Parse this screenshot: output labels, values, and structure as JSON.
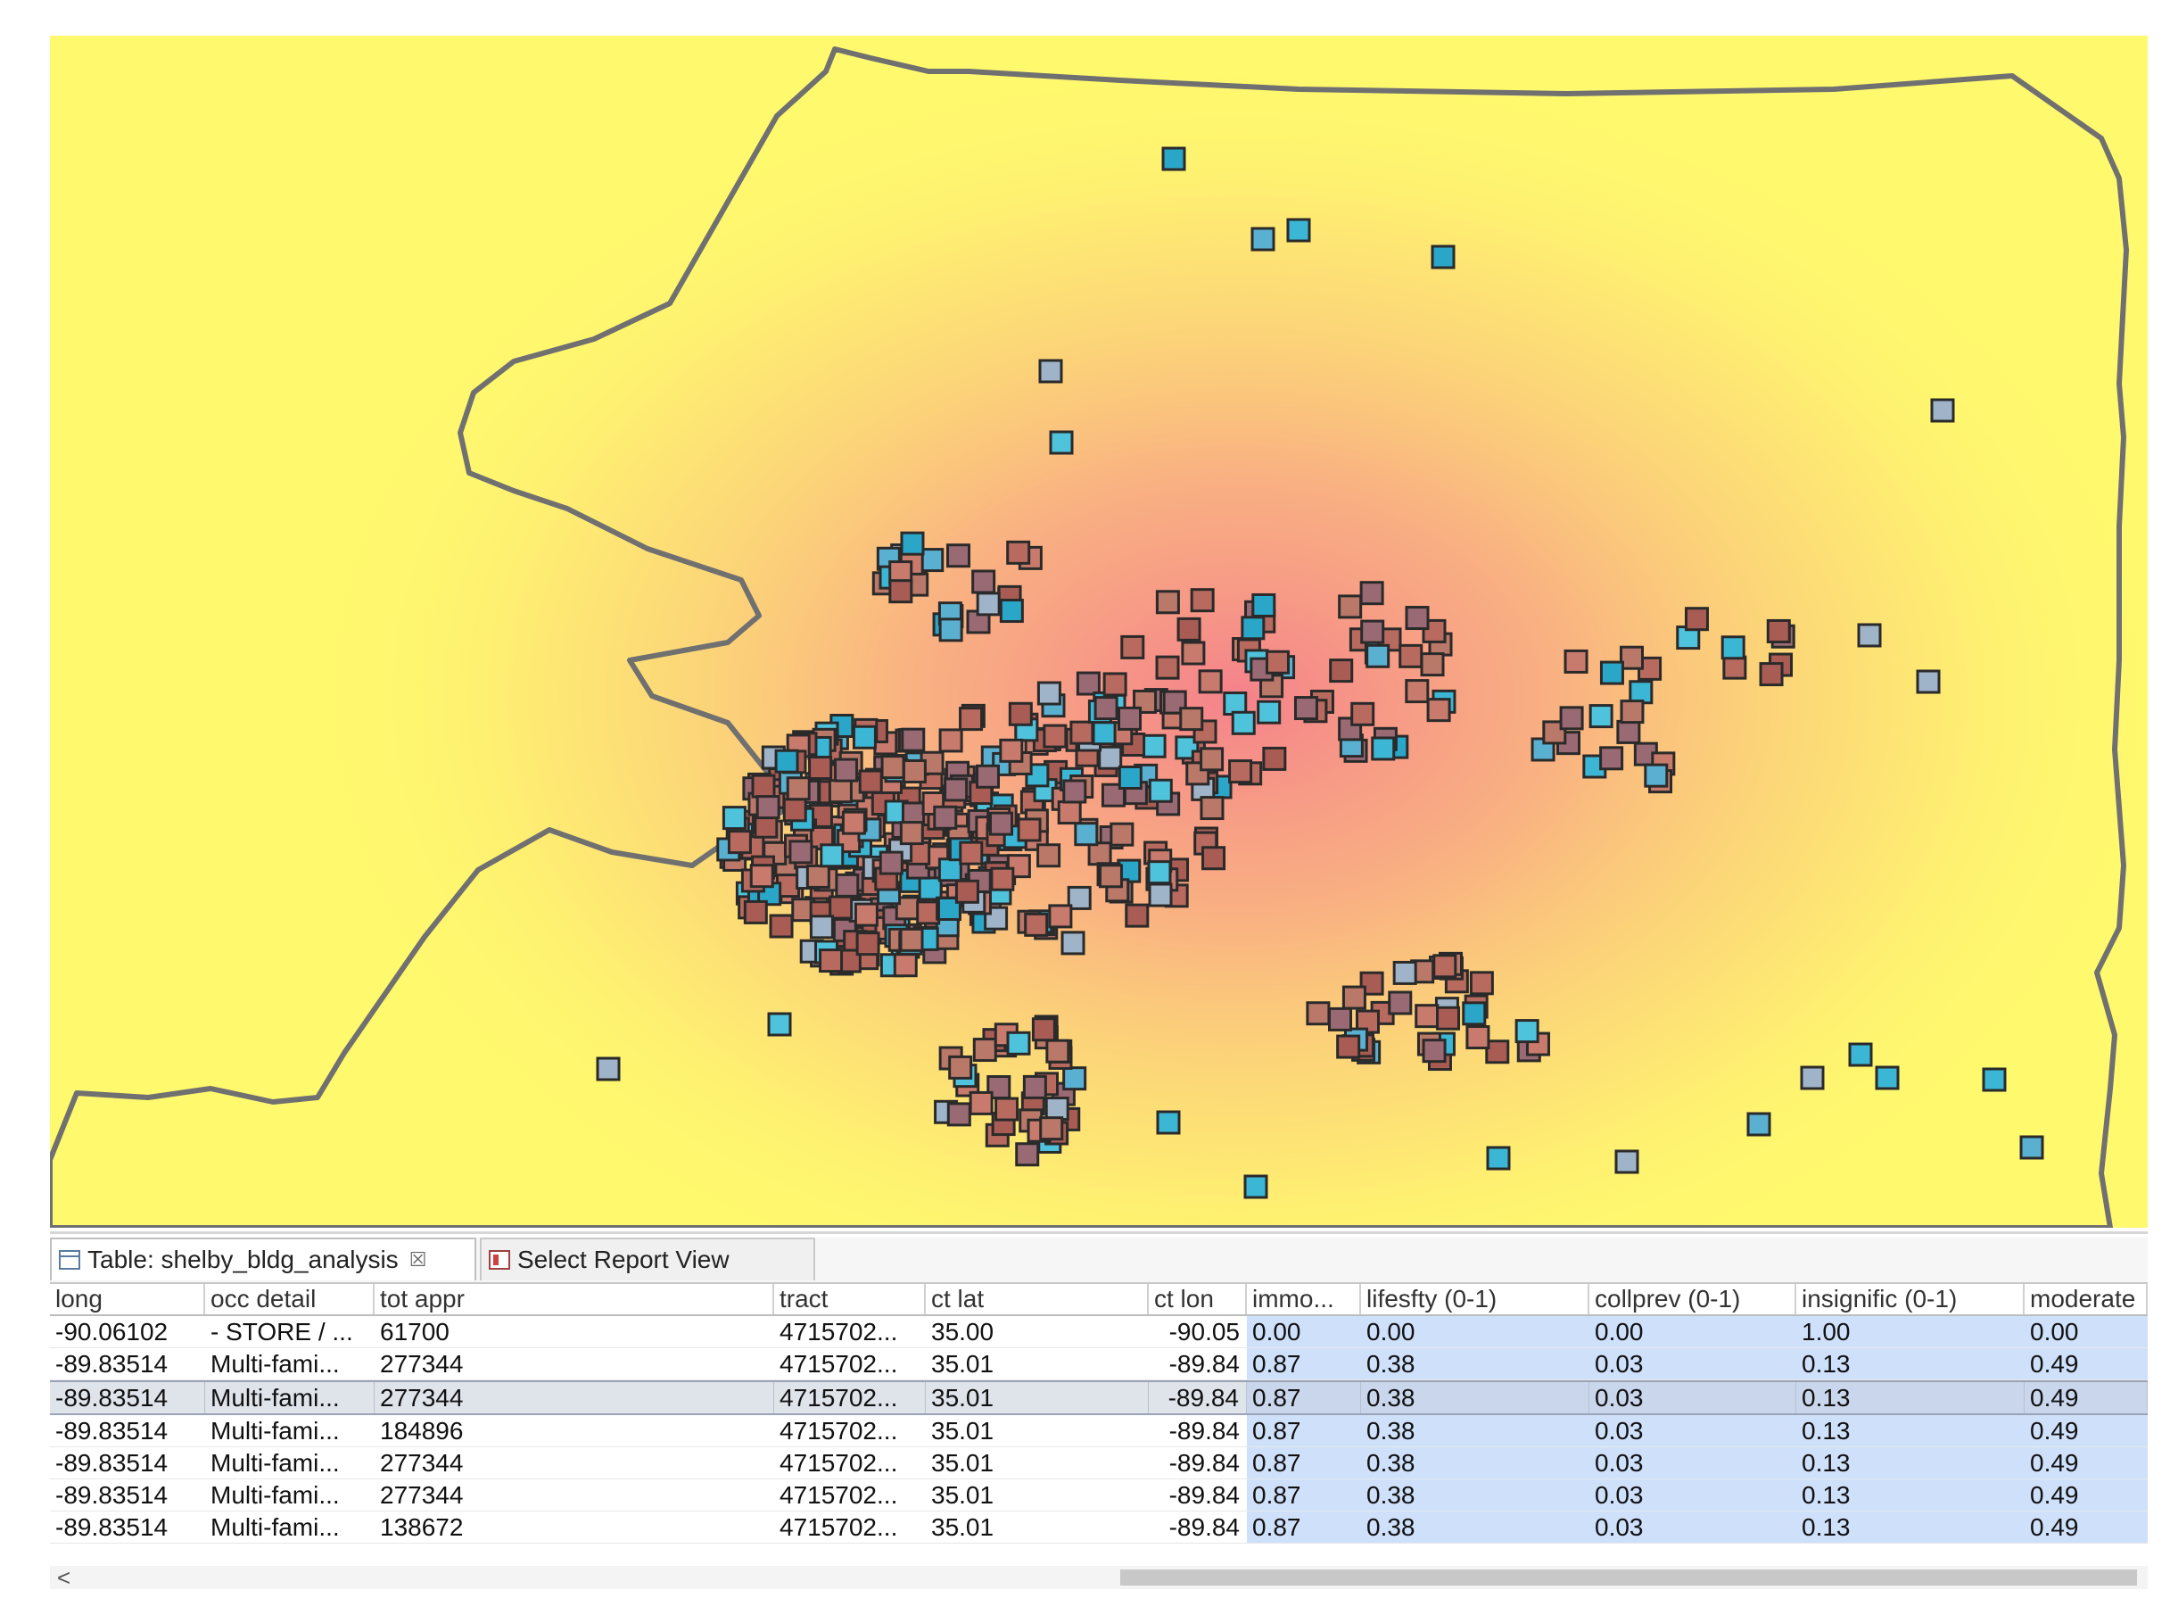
{
  "map": {
    "background_color": "#fff96e",
    "boundary_color": "#707070",
    "heat_color": "#f47c8c"
  },
  "tabs": [
    {
      "label": "Table: shelby_bldg_analysis",
      "close": "☒",
      "icon": "table-icon"
    },
    {
      "label": "Select Report View",
      "icon": "report-icon"
    }
  ],
  "table": {
    "columns": [
      "long",
      "occ detail",
      "tot appr",
      "tract",
      "ct lat",
      "ct lon",
      "immo...",
      "lifesfty (0-1)",
      "collprev (0-1)",
      "insignific (0-1)",
      "moderate"
    ],
    "rows": [
      [
        "-90.06102",
        "- STORE / ...",
        "61700",
        "4715702...",
        "35.00",
        "-90.05",
        "0.00",
        "0.00",
        "0.00",
        "1.00",
        "0.00"
      ],
      [
        "-89.83514",
        "Multi-fami...",
        "277344",
        "4715702...",
        "35.01",
        "-89.84",
        "0.87",
        "0.38",
        "0.03",
        "0.13",
        "0.49"
      ],
      [
        "-89.83514",
        "Multi-fami...",
        "277344",
        "4715702...",
        "35.01",
        "-89.84",
        "0.87",
        "0.38",
        "0.03",
        "0.13",
        "0.49"
      ],
      [
        "-89.83514",
        "Multi-fami...",
        "184896",
        "4715702...",
        "35.01",
        "-89.84",
        "0.87",
        "0.38",
        "0.03",
        "0.13",
        "0.49"
      ],
      [
        "-89.83514",
        "Multi-fami...",
        "277344",
        "4715702...",
        "35.01",
        "-89.84",
        "0.87",
        "0.38",
        "0.03",
        "0.13",
        "0.49"
      ],
      [
        "-89.83514",
        "Multi-fami...",
        "277344",
        "4715702...",
        "35.01",
        "-89.84",
        "0.87",
        "0.38",
        "0.03",
        "0.13",
        "0.49"
      ],
      [
        "-89.83514",
        "Multi-fami...",
        "138672",
        "4715702...",
        "35.01",
        "-89.84",
        "0.87",
        "0.38",
        "0.03",
        "0.13",
        "0.49"
      ]
    ],
    "selected_row": 2,
    "scroll_left_arrow": "<"
  }
}
